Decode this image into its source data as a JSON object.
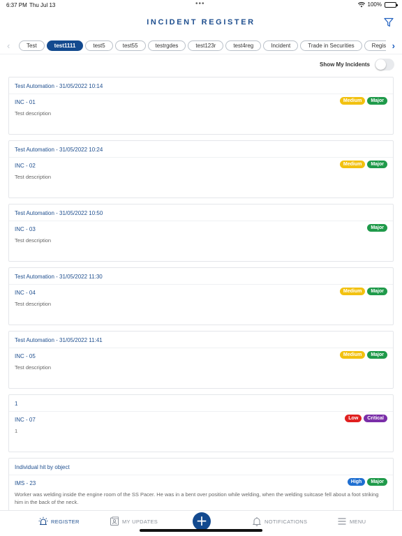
{
  "status_bar": {
    "time": "6:37 PM",
    "date": "Thu Jul 13",
    "battery": "100%",
    "battery_level": 1.0
  },
  "header": {
    "title": "INCIDENT REGISTER",
    "filter_icon": "filter-icon"
  },
  "tabs": [
    {
      "label": "Test",
      "active": false
    },
    {
      "label": "test1111",
      "active": true
    },
    {
      "label": "test5",
      "active": false
    },
    {
      "label": "test55",
      "active": false
    },
    {
      "label": "testrgdes",
      "active": false
    },
    {
      "label": "test123r",
      "active": false
    },
    {
      "label": "test4reg",
      "active": false
    },
    {
      "label": "Incident",
      "active": false
    },
    {
      "label": "Trade in Securities",
      "active": false
    },
    {
      "label": "Registe",
      "active": false
    }
  ],
  "toggle": {
    "label": "Show My Incidents",
    "on": false
  },
  "colors": {
    "primary": "#134a8f",
    "link": "#1f4f8f",
    "medium": "#f2c110",
    "major": "#1f9a4a",
    "low": "#e02020",
    "critical": "#7a2ea8",
    "high": "#1f6fd1"
  },
  "incidents": [
    {
      "header": "Test Automation - 31/05/2022 10:14",
      "id": "INC - 01",
      "description": "Test description",
      "badges": [
        {
          "label": "Medium",
          "color": "#f2c110"
        },
        {
          "label": "Major",
          "color": "#1f9a4a"
        }
      ]
    },
    {
      "header": "Test Automation - 31/05/2022 10:24",
      "id": "INC - 02",
      "description": "Test description",
      "badges": [
        {
          "label": "Medium",
          "color": "#f2c110"
        },
        {
          "label": "Major",
          "color": "#1f9a4a"
        }
      ]
    },
    {
      "header": "Test Automation - 31/05/2022 10:50",
      "id": "INC - 03",
      "description": "Test description",
      "badges": [
        {
          "label": "Major",
          "color": "#1f9a4a"
        }
      ]
    },
    {
      "header": "Test Automation - 31/05/2022 11:30",
      "id": "INC - 04",
      "description": "Test description",
      "badges": [
        {
          "label": "Medium",
          "color": "#f2c110"
        },
        {
          "label": "Major",
          "color": "#1f9a4a"
        }
      ]
    },
    {
      "header": "Test Automation - 31/05/2022 11:41",
      "id": "INC - 05",
      "description": "Test description",
      "badges": [
        {
          "label": "Medium",
          "color": "#f2c110"
        },
        {
          "label": "Major",
          "color": "#1f9a4a"
        }
      ]
    },
    {
      "header": "1",
      "id": "INC - 07",
      "description": "1",
      "badges": [
        {
          "label": "Low",
          "color": "#e02020"
        },
        {
          "label": "Critical",
          "color": "#7a2ea8"
        }
      ]
    },
    {
      "header": "Individual hit by object",
      "id": "IMS - 23",
      "description": "Worker was welding inside the engine room of the SS Pacer. He was in a bent over position while welding, when the welding suitcase fell about a foot striking him in the back of the neck.",
      "badges": [
        {
          "label": "High",
          "color": "#1f6fd1"
        },
        {
          "label": "Major",
          "color": "#1f9a4a"
        }
      ]
    }
  ],
  "bottom_nav": {
    "register": "REGISTER",
    "my_updates": "MY UPDATES",
    "add": "+",
    "notifications": "NOTIFICATIONS",
    "menu": "MENU"
  }
}
